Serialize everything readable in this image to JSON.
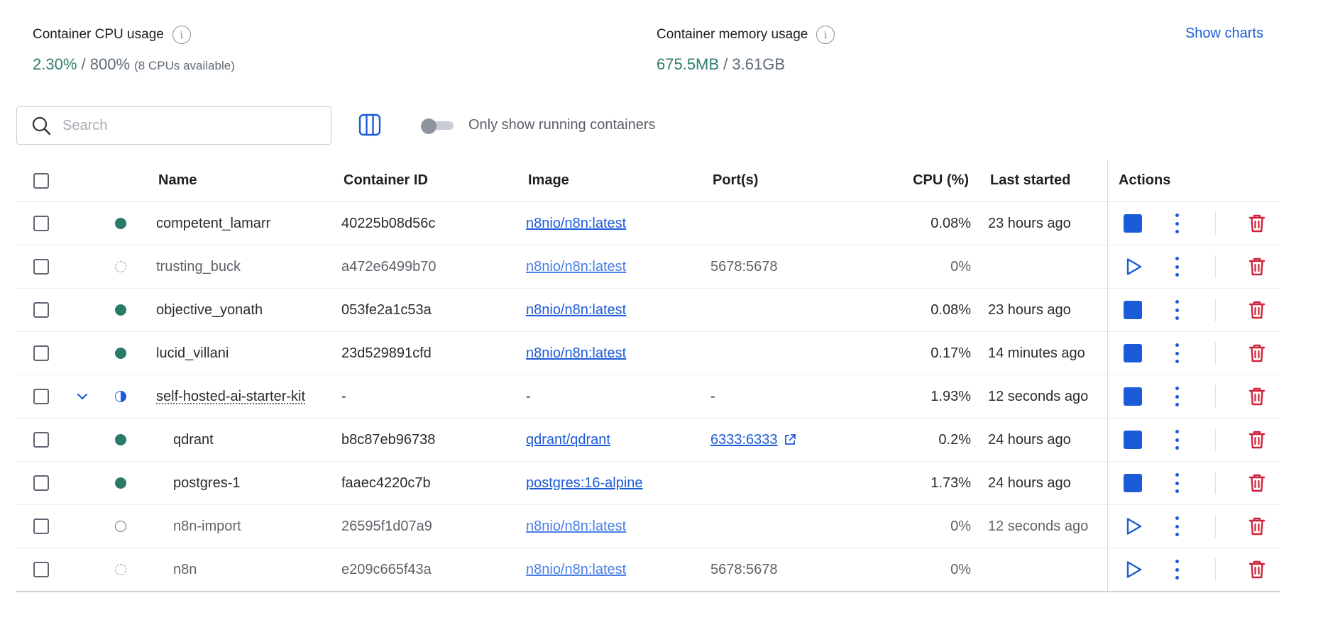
{
  "stats": {
    "cpu": {
      "title": "Container CPU usage",
      "used": "2.30%",
      "separator": " / ",
      "total": "800%",
      "note": "(8 CPUs available)"
    },
    "memory": {
      "title": "Container memory usage",
      "used": "675.5MB",
      "separator": " / ",
      "total": "3.61GB"
    },
    "info_glyph": "i",
    "show_charts": "Show charts"
  },
  "toolbar": {
    "search_placeholder": "Search",
    "toggle_label": "Only show running containers",
    "toggle_on": false
  },
  "table": {
    "columns": {
      "name": "Name",
      "container_id": "Container ID",
      "image": "Image",
      "ports": "Port(s)",
      "cpu": "CPU (%)",
      "last_started": "Last started",
      "actions": "Actions"
    },
    "rows": [
      {
        "name": "competent_lamarr",
        "status": "running",
        "id": "40225b08d56c",
        "image": "n8nio/n8n:latest",
        "ports": "",
        "cpu": "0.08%",
        "last_started": "23 hours ago",
        "action": "stop"
      },
      {
        "name": "trusting_buck",
        "status": "stopped",
        "id": "a472e6499b70",
        "image": "n8nio/n8n:latest",
        "ports": "5678:5678",
        "cpu": "0%",
        "last_started": "",
        "action": "start"
      },
      {
        "name": "objective_yonath",
        "status": "running",
        "id": "053fe2a1c53a",
        "image": "n8nio/n8n:latest",
        "ports": "",
        "cpu": "0.08%",
        "last_started": "23 hours ago",
        "action": "stop"
      },
      {
        "name": "lucid_villani",
        "status": "running",
        "id": "23d529891cfd",
        "image": "n8nio/n8n:latest",
        "ports": "",
        "cpu": "0.17%",
        "last_started": "14 minutes ago",
        "action": "stop"
      },
      {
        "name": "self-hosted-ai-starter-kit",
        "status": "partial",
        "id": "-",
        "image": "-",
        "ports": "-",
        "cpu": "1.93%",
        "last_started": "12 seconds ago",
        "action": "stop",
        "group": true,
        "expand_icon": "chevron-down-icon"
      },
      {
        "name": "qdrant",
        "status": "running",
        "id": "b8c87eb96738",
        "image": "qdrant/qdrant",
        "ports": "6333:6333",
        "ports_link": true,
        "cpu": "0.2%",
        "last_started": "24 hours ago",
        "action": "stop",
        "child": true
      },
      {
        "name": "postgres-1",
        "status": "running",
        "id": "faaec4220c7b",
        "image": "postgres:16-alpine",
        "ports": "",
        "cpu": "1.73%",
        "last_started": "24 hours ago",
        "action": "stop",
        "child": true
      },
      {
        "name": "n8n-import",
        "status": "exited",
        "id": "26595f1d07a9",
        "image": "n8nio/n8n:latest",
        "ports": "",
        "cpu": "0%",
        "last_started": "12 seconds ago",
        "action": "start",
        "child": true
      },
      {
        "name": "n8n",
        "status": "stopped",
        "id": "e209c665f43a",
        "image": "n8nio/n8n:latest",
        "ports": "5678:5678",
        "cpu": "0%",
        "last_started": "",
        "action": "start",
        "child": true
      }
    ]
  },
  "colors": {
    "accent": "#1c5bd8",
    "running": "#2a7a6a",
    "delete": "#d0243a",
    "value_green": "#2f7d6d"
  }
}
